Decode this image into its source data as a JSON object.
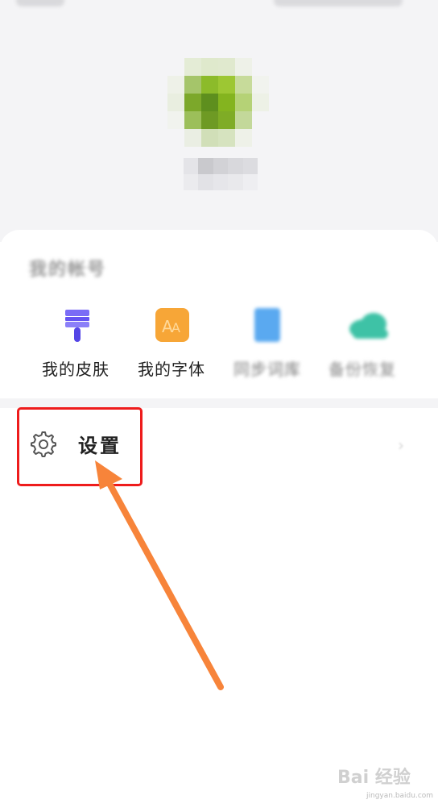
{
  "profile": {
    "account_section_title": "我的帐号"
  },
  "quick_actions": [
    {
      "label": "我的皮肤",
      "icon": "paint-brush-icon",
      "color": "#6f5ff2"
    },
    {
      "label": "我的字体",
      "icon": "font-icon",
      "color": "#f7a637"
    },
    {
      "label": "同步词库",
      "icon": "document-icon",
      "color": "#5aa9f0"
    },
    {
      "label": "备份恢复",
      "icon": "cloud-icon",
      "color": "#3ec2a6"
    }
  ],
  "settings": {
    "icon": "gear-icon",
    "label": "设置"
  },
  "annotation": {
    "highlight_color": "#ee1c1c",
    "arrow_color": "#f7843a"
  },
  "watermark": {
    "brand": "Bai 经验",
    "url": "jingyan.baidu.com"
  }
}
